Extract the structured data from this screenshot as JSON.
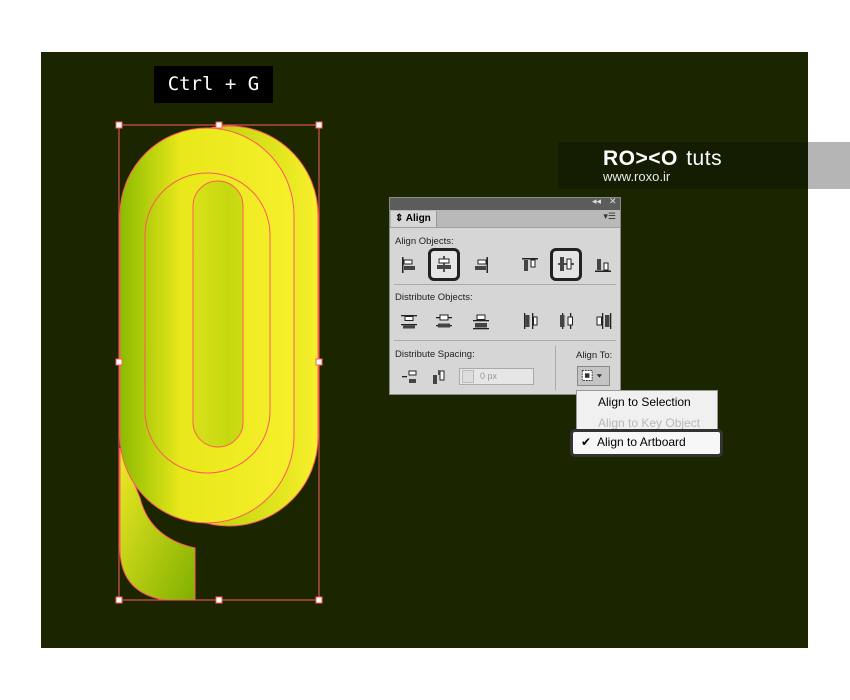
{
  "canvas": {
    "background": "#1b2601"
  },
  "shortcut": {
    "label": "Ctrl + G"
  },
  "watermark": {
    "brand": "RO><O",
    "brand_suffix": "tuts",
    "url": "www.roxo.ir"
  },
  "align_panel": {
    "collapse_icon": "double-chevron-icon",
    "close_icon": "close-icon",
    "tab_label": "Align",
    "menu_icon": "panel-menu-icon",
    "align_objects_label": "Align Objects:",
    "align_buttons": [
      "horizontal-align-left-icon",
      "horizontal-align-center-icon",
      "horizontal-align-right-icon",
      "vertical-align-top-icon",
      "vertical-align-center-icon",
      "vertical-align-bottom-icon"
    ],
    "distribute_objects_label": "Distribute Objects:",
    "distribute_buttons": [
      "vertical-distribute-top-icon",
      "vertical-distribute-center-icon",
      "vertical-distribute-bottom-icon",
      "horizontal-distribute-left-icon",
      "horizontal-distribute-center-icon",
      "horizontal-distribute-right-icon"
    ],
    "distribute_spacing_label": "Distribute Spacing:",
    "spacing_value": "0 px",
    "align_to_label": "Align To:"
  },
  "align_to_menu": {
    "items": [
      {
        "label": "Align to Selection",
        "enabled": true,
        "checked": false
      },
      {
        "label": "Align to Key Object",
        "enabled": false,
        "checked": false
      },
      {
        "label": "Align to Artboard",
        "enabled": true,
        "checked": true
      }
    ],
    "check_mark": "✔"
  },
  "colors": {
    "highlight": "#222222",
    "selection": "#ff5a5a",
    "letter_light": "#f2ec2a",
    "letter_dark": "#8ab800"
  }
}
